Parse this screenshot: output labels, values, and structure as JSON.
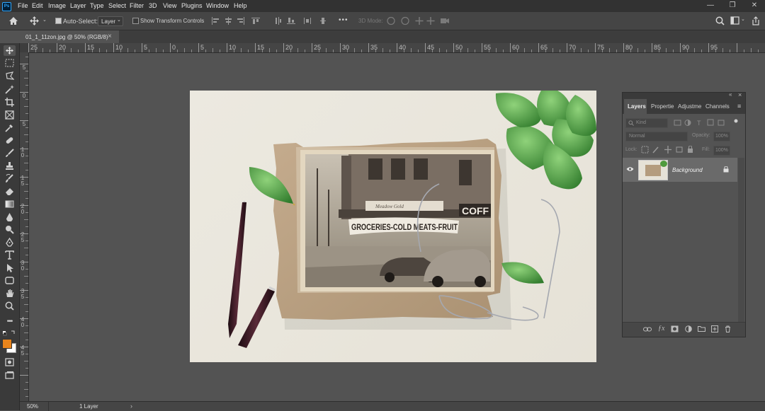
{
  "app": {
    "logo_text": "Ps"
  },
  "menu": [
    "File",
    "Edit",
    "Image",
    "Layer",
    "Type",
    "Select",
    "Filter",
    "3D",
    "View",
    "Plugins",
    "Window",
    "Help"
  ],
  "window_controls": {
    "minimize": "—",
    "restore": "❐",
    "close": "✕"
  },
  "options_bar": {
    "auto_select_label": "Auto-Select:",
    "auto_select_target": "Layer",
    "show_transform_label": "Show Transform Controls",
    "more": "•••",
    "mode_3d_label": "3D Mode:"
  },
  "document_tab": {
    "title": "01_1_11zon.jpg @ 50% (RGB/8)",
    "close": "×"
  },
  "ruler_h": [
    "25",
    "20",
    "15",
    "10",
    "5",
    "0",
    "5",
    "10",
    "15",
    "20",
    "25",
    "30",
    "35",
    "40",
    "45",
    "50",
    "55",
    "60",
    "65",
    "70",
    "75",
    "80",
    "85",
    "90",
    "95"
  ],
  "ruler_v": [
    "5",
    "0",
    "5",
    "1 0",
    "1 5",
    "2 0",
    "2 5",
    "3 0",
    "3 5",
    "4 0",
    "4 5"
  ],
  "status_bar": {
    "zoom": "50%",
    "info": "1 Layer",
    "arrow": "›"
  },
  "canvas": {
    "sign_text": "GROCERIES-COLD MEATS-FRUIT",
    "coffee_text": "COFF",
    "store_text": "Meadow Gold"
  },
  "layers_panel": {
    "tabs": [
      "Layers",
      "Propertie",
      "Adjustme",
      "Channels"
    ],
    "filter_kind": "Kind",
    "blend_mode": "Normal",
    "opacity_label": "Opacity:",
    "opacity_value": "100%",
    "lock_label": "Lock:",
    "fill_label": "Fill:",
    "fill_value": "100%",
    "layers": [
      {
        "name": "Background",
        "visible": true,
        "locked": true
      }
    ]
  },
  "colors": {
    "foreground": "#e8841c",
    "background": "#ffffff",
    "accent": "#31a8ff"
  }
}
